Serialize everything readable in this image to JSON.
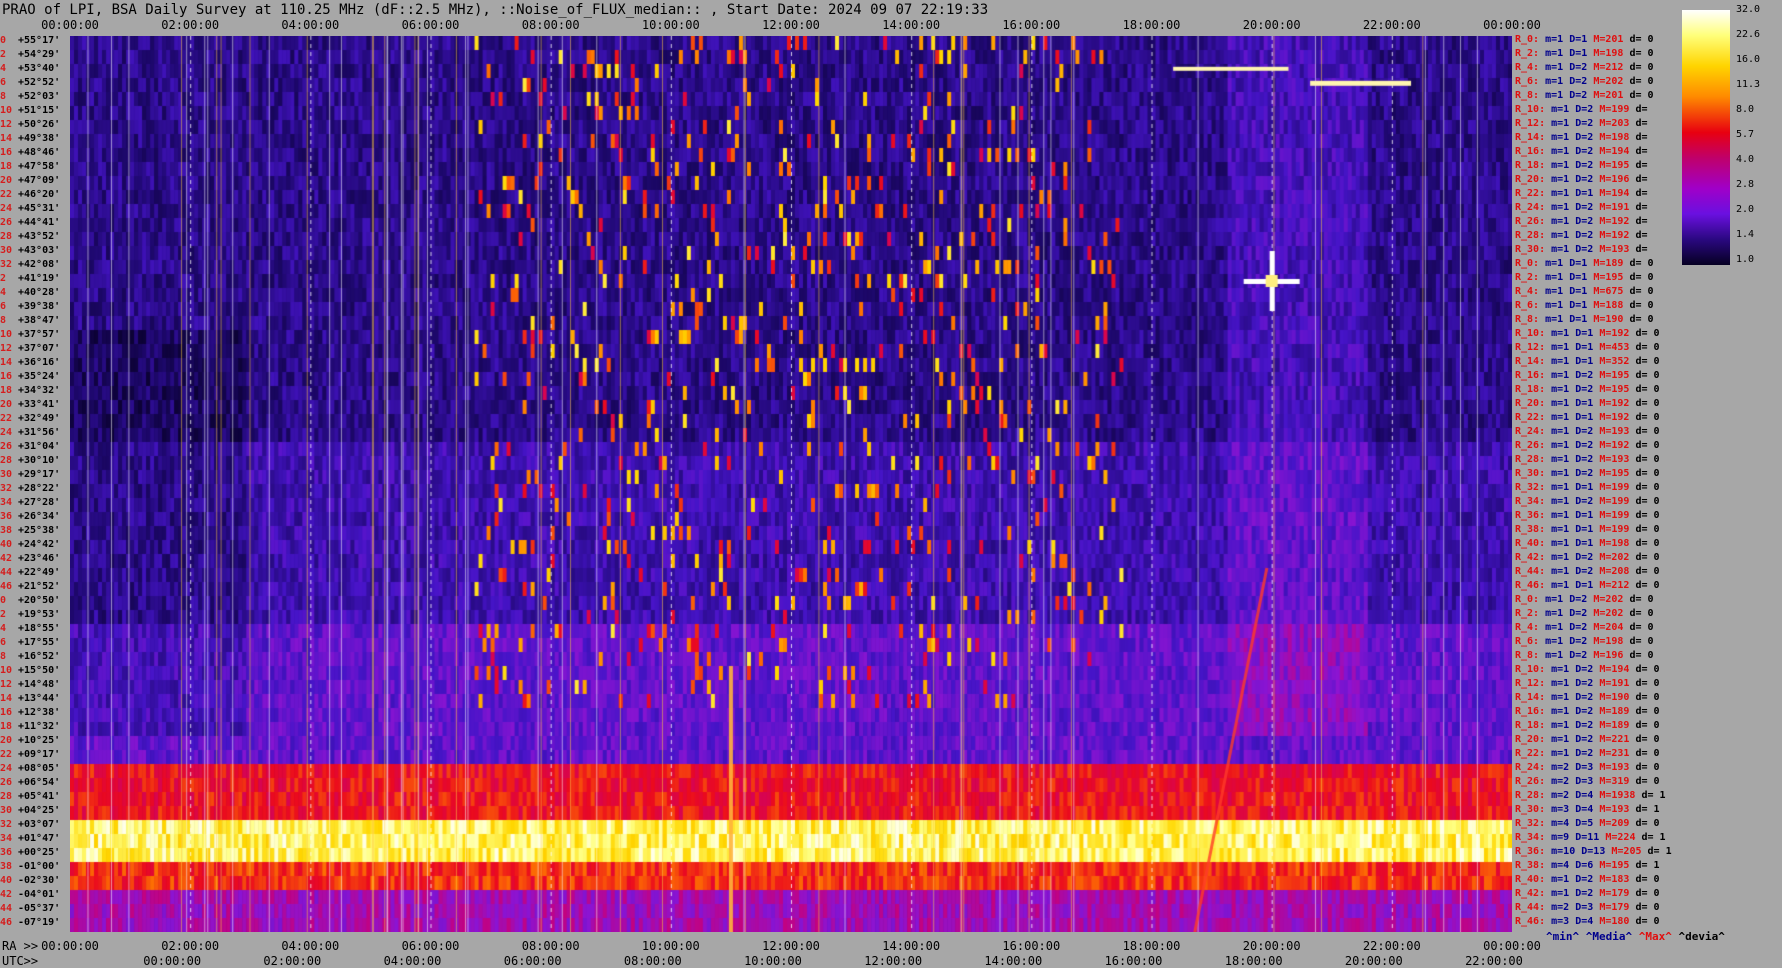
{
  "title": "PRAO of LPI, BSA Daily Survey at 110.25 MHz (dF::2.5 MHz), ::Noise_of_FLUX_median:: , Start Date: 2024 09 07 22:19:33",
  "top_ticks": [
    "00:00:00",
    "02:00:00",
    "04:00:00",
    "06:00:00",
    "08:00:00",
    "10:00:00",
    "12:00:00",
    "14:00:00",
    "16:00:00",
    "18:00:00",
    "20:00:00",
    "22:00:00",
    "00:00:00"
  ],
  "ra_prefix": "RA >>",
  "ra_ticks": [
    "00:00:00",
    "02:00:00",
    "04:00:00",
    "06:00:00",
    "08:00:00",
    "10:00:00",
    "12:00:00",
    "14:00:00",
    "16:00:00",
    "18:00:00",
    "20:00:00",
    "22:00:00",
    "00:00:00"
  ],
  "utc_prefix": "UTC>>",
  "utc_ticks": [
    "00:00:00",
    "02:00:00",
    "04:00:00",
    "06:00:00",
    "08:00:00",
    "10:00:00",
    "12:00:00",
    "14:00:00",
    "16:00:00",
    "18:00:00",
    "20:00:00",
    "22:00:00"
  ],
  "colorbar_labels": [
    "32.0",
    "22.6",
    "16.0",
    "11.3",
    "8.0",
    "5.7",
    "4.0",
    "2.8",
    "2.0",
    "1.4",
    "1.0"
  ],
  "legend": {
    "min": "^min^",
    "median": "^Media^",
    "max": "^Max^",
    "dev": "^devia^"
  },
  "declinations": [
    {
      "i": "0",
      "d": "+55°17'"
    },
    {
      "i": "2",
      "d": "+54°29'"
    },
    {
      "i": "4",
      "d": "+53°40'"
    },
    {
      "i": "6",
      "d": "+52°52'"
    },
    {
      "i": "8",
      "d": "+52°03'"
    },
    {
      "i": "10",
      "d": "+51°15'"
    },
    {
      "i": "12",
      "d": "+50°26'"
    },
    {
      "i": "14",
      "d": "+49°38'"
    },
    {
      "i": "16",
      "d": "+48°46'"
    },
    {
      "i": "18",
      "d": "+47°58'"
    },
    {
      "i": "20",
      "d": "+47°09'"
    },
    {
      "i": "22",
      "d": "+46°20'"
    },
    {
      "i": "24",
      "d": "+45°31'"
    },
    {
      "i": "26",
      "d": "+44°41'"
    },
    {
      "i": "28",
      "d": "+43°52'"
    },
    {
      "i": "30",
      "d": "+43°03'"
    },
    {
      "i": "32",
      "d": "+42°08'"
    },
    {
      "i": "2",
      "d": "+41°19'"
    },
    {
      "i": "4",
      "d": "+40°28'"
    },
    {
      "i": "6",
      "d": "+39°38'"
    },
    {
      "i": "8",
      "d": "+38°47'"
    },
    {
      "i": "10",
      "d": "+37°57'"
    },
    {
      "i": "12",
      "d": "+37°07'"
    },
    {
      "i": "14",
      "d": "+36°16'"
    },
    {
      "i": "16",
      "d": "+35°24'"
    },
    {
      "i": "18",
      "d": "+34°32'"
    },
    {
      "i": "20",
      "d": "+33°41'"
    },
    {
      "i": "22",
      "d": "+32°49'"
    },
    {
      "i": "24",
      "d": "+31°56'"
    },
    {
      "i": "26",
      "d": "+31°04'"
    },
    {
      "i": "28",
      "d": "+30°10'"
    },
    {
      "i": "30",
      "d": "+29°17'"
    },
    {
      "i": "32",
      "d": "+28°22'"
    },
    {
      "i": "34",
      "d": "+27°28'"
    },
    {
      "i": "36",
      "d": "+26°34'"
    },
    {
      "i": "38",
      "d": "+25°38'"
    },
    {
      "i": "40",
      "d": "+24°42'"
    },
    {
      "i": "42",
      "d": "+23°46'"
    },
    {
      "i": "44",
      "d": "+22°49'"
    },
    {
      "i": "46",
      "d": "+21°52'"
    },
    {
      "i": "0",
      "d": "+20°50'"
    },
    {
      "i": "2",
      "d": "+19°53'"
    },
    {
      "i": "4",
      "d": "+18°55'"
    },
    {
      "i": "6",
      "d": "+17°55'"
    },
    {
      "i": "8",
      "d": "+16°52'"
    },
    {
      "i": "10",
      "d": "+15°50'"
    },
    {
      "i": "12",
      "d": "+14°48'"
    },
    {
      "i": "14",
      "d": "+13°44'"
    },
    {
      "i": "16",
      "d": "+12°38'"
    },
    {
      "i": "18",
      "d": "+11°32'"
    },
    {
      "i": "20",
      "d": "+10°25'"
    },
    {
      "i": "22",
      "d": "+09°17'"
    },
    {
      "i": "24",
      "d": "+08°05'"
    },
    {
      "i": "26",
      "d": "+06°54'"
    },
    {
      "i": "28",
      "d": "+05°41'"
    },
    {
      "i": "30",
      "d": "+04°25'"
    },
    {
      "i": "32",
      "d": "+03°07'"
    },
    {
      "i": "34",
      "d": "+01°47'"
    },
    {
      "i": "36",
      "d": "+00°25'"
    },
    {
      "i": "38",
      "d": "-01°00'"
    },
    {
      "i": "40",
      "d": "-02°30'"
    },
    {
      "i": "42",
      "d": "-04°01'"
    },
    {
      "i": "44",
      "d": "-05°37'"
    },
    {
      "i": "46",
      "d": "-07°19'"
    }
  ],
  "stats": [
    {
      "r": "R_0:",
      "m": "m=1",
      "D": "D=1",
      "M": "M=201",
      "d": "d= 0"
    },
    {
      "r": "R_2:",
      "m": "m=1",
      "D": "D=1",
      "M": "M=198",
      "d": "d= 0"
    },
    {
      "r": "R_4:",
      "m": "m=1",
      "D": "D=2",
      "M": "M=212",
      "d": "d= 0"
    },
    {
      "r": "R_6:",
      "m": "m=1",
      "D": "D=2",
      "M": "M=202",
      "d": "d= 0"
    },
    {
      "r": "R_8:",
      "m": "m=1",
      "D": "D=2",
      "M": "M=201",
      "d": "d= 0"
    },
    {
      "r": "R_10:",
      "m": "m=1",
      "D": "D=2",
      "M": "M=199",
      "d": "d="
    },
    {
      "r": "R_12:",
      "m": "m=1",
      "D": "D=2",
      "M": "M=203",
      "d": "d="
    },
    {
      "r": "R_14:",
      "m": "m=1",
      "D": "D=2",
      "M": "M=198",
      "d": "d="
    },
    {
      "r": "R_16:",
      "m": "m=1",
      "D": "D=2",
      "M": "M=194",
      "d": "d="
    },
    {
      "r": "R_18:",
      "m": "m=1",
      "D": "D=2",
      "M": "M=195",
      "d": "d="
    },
    {
      "r": "R_20:",
      "m": "m=1",
      "D": "D=2",
      "M": "M=196",
      "d": "d="
    },
    {
      "r": "R_22:",
      "m": "m=1",
      "D": "D=1",
      "M": "M=194",
      "d": "d="
    },
    {
      "r": "R_24:",
      "m": "m=1",
      "D": "D=2",
      "M": "M=191",
      "d": "d="
    },
    {
      "r": "R_26:",
      "m": "m=1",
      "D": "D=2",
      "M": "M=192",
      "d": "d="
    },
    {
      "r": "R_28:",
      "m": "m=1",
      "D": "D=2",
      "M": "M=192",
      "d": "d="
    },
    {
      "r": "R_30:",
      "m": "m=1",
      "D": "D=2",
      "M": "M=193",
      "d": "d="
    },
    {
      "r": "R_0:",
      "m": "m=1",
      "D": "D=1",
      "M": "M=189",
      "d": "d= 0"
    },
    {
      "r": "R_2:",
      "m": "m=1",
      "D": "D=1",
      "M": "M=195",
      "d": "d= 0"
    },
    {
      "r": "R_4:",
      "m": "m=1",
      "D": "D=1",
      "M": "M=675",
      "d": "d= 0"
    },
    {
      "r": "R_6:",
      "m": "m=1",
      "D": "D=1",
      "M": "M=188",
      "d": "d= 0"
    },
    {
      "r": "R_8:",
      "m": "m=1",
      "D": "D=1",
      "M": "M=190",
      "d": "d= 0"
    },
    {
      "r": "R_10:",
      "m": "m=1",
      "D": "D=1",
      "M": "M=192",
      "d": "d= 0"
    },
    {
      "r": "R_12:",
      "m": "m=1",
      "D": "D=1",
      "M": "M=453",
      "d": "d= 0"
    },
    {
      "r": "R_14:",
      "m": "m=1",
      "D": "D=1",
      "M": "M=352",
      "d": "d= 0"
    },
    {
      "r": "R_16:",
      "m": "m=1",
      "D": "D=2",
      "M": "M=195",
      "d": "d= 0"
    },
    {
      "r": "R_18:",
      "m": "m=1",
      "D": "D=2",
      "M": "M=195",
      "d": "d= 0"
    },
    {
      "r": "R_20:",
      "m": "m=1",
      "D": "D=1",
      "M": "M=192",
      "d": "d= 0"
    },
    {
      "r": "R_22:",
      "m": "m=1",
      "D": "D=1",
      "M": "M=192",
      "d": "d= 0"
    },
    {
      "r": "R_24:",
      "m": "m=1",
      "D": "D=2",
      "M": "M=193",
      "d": "d= 0"
    },
    {
      "r": "R_26:",
      "m": "m=1",
      "D": "D=2",
      "M": "M=192",
      "d": "d= 0"
    },
    {
      "r": "R_28:",
      "m": "m=1",
      "D": "D=2",
      "M": "M=193",
      "d": "d= 0"
    },
    {
      "r": "R_30:",
      "m": "m=1",
      "D": "D=2",
      "M": "M=195",
      "d": "d= 0"
    },
    {
      "r": "R_32:",
      "m": "m=1",
      "D": "D=1",
      "M": "M=199",
      "d": "d= 0"
    },
    {
      "r": "R_34:",
      "m": "m=1",
      "D": "D=2",
      "M": "M=199",
      "d": "d= 0"
    },
    {
      "r": "R_36:",
      "m": "m=1",
      "D": "D=1",
      "M": "M=199",
      "d": "d= 0"
    },
    {
      "r": "R_38:",
      "m": "m=1",
      "D": "D=1",
      "M": "M=199",
      "d": "d= 0"
    },
    {
      "r": "R_40:",
      "m": "m=1",
      "D": "D=1",
      "M": "M=198",
      "d": "d= 0"
    },
    {
      "r": "R_42:",
      "m": "m=1",
      "D": "D=2",
      "M": "M=202",
      "d": "d= 0"
    },
    {
      "r": "R_44:",
      "m": "m=1",
      "D": "D=2",
      "M": "M=208",
      "d": "d= 0"
    },
    {
      "r": "R_46:",
      "m": "m=1",
      "D": "D=1",
      "M": "M=212",
      "d": "d= 0"
    },
    {
      "r": "R_0:",
      "m": "m=1",
      "D": "D=2",
      "M": "M=202",
      "d": "d= 0"
    },
    {
      "r": "R_2:",
      "m": "m=1",
      "D": "D=2",
      "M": "M=202",
      "d": "d= 0"
    },
    {
      "r": "R_4:",
      "m": "m=1",
      "D": "D=2",
      "M": "M=204",
      "d": "d= 0"
    },
    {
      "r": "R_6:",
      "m": "m=1",
      "D": "D=2",
      "M": "M=198",
      "d": "d= 0"
    },
    {
      "r": "R_8:",
      "m": "m=1",
      "D": "D=2",
      "M": "M=196",
      "d": "d= 0"
    },
    {
      "r": "R_10:",
      "m": "m=1",
      "D": "D=2",
      "M": "M=194",
      "d": "d= 0"
    },
    {
      "r": "R_12:",
      "m": "m=1",
      "D": "D=2",
      "M": "M=191",
      "d": "d= 0"
    },
    {
      "r": "R_14:",
      "m": "m=1",
      "D": "D=2",
      "M": "M=190",
      "d": "d= 0"
    },
    {
      "r": "R_16:",
      "m": "m=1",
      "D": "D=2",
      "M": "M=189",
      "d": "d= 0"
    },
    {
      "r": "R_18:",
      "m": "m=1",
      "D": "D=2",
      "M": "M=189",
      "d": "d= 0"
    },
    {
      "r": "R_20:",
      "m": "m=1",
      "D": "D=2",
      "M": "M=221",
      "d": "d= 0"
    },
    {
      "r": "R_22:",
      "m": "m=1",
      "D": "D=2",
      "M": "M=231",
      "d": "d= 0"
    },
    {
      "r": "R_24:",
      "m": "m=2",
      "D": "D=3",
      "M": "M=193",
      "d": "d= 0"
    },
    {
      "r": "R_26:",
      "m": "m=2",
      "D": "D=3",
      "M": "M=319",
      "d": "d= 0"
    },
    {
      "r": "R_28:",
      "m": "m=2",
      "D": "D=4",
      "M": "M=1938",
      "d": "d= 1"
    },
    {
      "r": "R_30:",
      "m": "m=3",
      "D": "D=4",
      "M": "M=193",
      "d": "d= 1"
    },
    {
      "r": "R_32:",
      "m": "m=4",
      "D": "D=5",
      "M": "M=209",
      "d": "d= 0"
    },
    {
      "r": "R_34:",
      "m": "m=9",
      "D": "D=11",
      "M": "M=224",
      "d": "d= 1"
    },
    {
      "r": "R_36:",
      "m": "m=10",
      "D": "D=13",
      "M": "M=205",
      "d": "d= 1"
    },
    {
      "r": "R_38:",
      "m": "m=4",
      "D": "D=6",
      "M": "M=195",
      "d": "d= 1"
    },
    {
      "r": "R_40:",
      "m": "m=1",
      "D": "D=2",
      "M": "M=183",
      "d": "d= 0"
    },
    {
      "r": "R_42:",
      "m": "m=1",
      "D": "D=2",
      "M": "M=179",
      "d": "d= 0"
    },
    {
      "r": "R_44:",
      "m": "m=2",
      "D": "D=3",
      "M": "M=179",
      "d": "d= 0"
    },
    {
      "r": "R_46:",
      "m": "m=3",
      "D": "D=4",
      "M": "M=180",
      "d": "d= 0"
    }
  ],
  "chart_data": {
    "type": "heatmap",
    "title": "PRAO of LPI, BSA Daily Survey at 110.25 MHz (dF::2.5 MHz), ::Noise_of_FLUX_median:: , Start Date: 2024 09 07 22:19:33",
    "x_axis": "RA / UTC (hh:mm:ss)",
    "y_axis": "Declination",
    "color_scale": [
      1.0,
      32.0
    ],
    "bright_features": [
      {
        "desc": "continuous bright band",
        "dec": "+01°47' to -01°00'",
        "ra": "00:00:00 to 24:00:00"
      },
      {
        "desc": "strong source cross",
        "dec": "+41°19'",
        "ra": "20:00:00"
      },
      {
        "desc": "vertical burst",
        "dec": "+14°48' to -07°19'",
        "ra": "11:00:00"
      }
    ]
  }
}
